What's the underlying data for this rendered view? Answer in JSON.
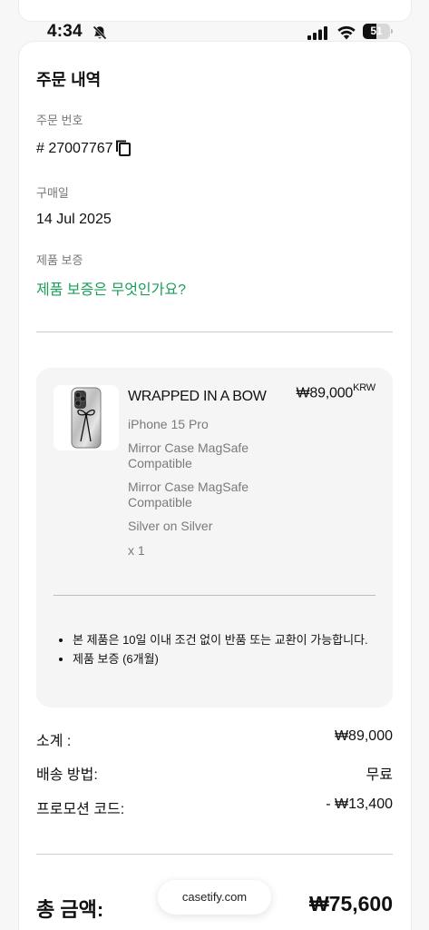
{
  "status_bar": {
    "time": "4:34",
    "battery": "51",
    "battery_fraction": 0.51,
    "icons": [
      "bell-slash-icon",
      "signal-icon",
      "wifi-icon",
      "battery-icon"
    ]
  },
  "order": {
    "title": "주문 내역",
    "order_number_label": "주문 번호",
    "order_number": "# 27007767",
    "purchase_date_label": "구매일",
    "purchase_date": "14 Jul 2025",
    "warranty_label": "제품 보증",
    "warranty_link": "제품 보증은 무엇인가요?"
  },
  "product": {
    "name": "WRAPPED IN A BOW",
    "price": "₩89,000",
    "currency": "KRW",
    "model": "iPhone 15 Pro",
    "case_type_1": "Mirror Case MagSafe Compatible",
    "case_type_2": "Mirror Case MagSafe Compatible",
    "color": "Silver on Silver",
    "quantity": "x 1",
    "notes": [
      "본 제품은 10일 이내 조건 없이 반품 또는 교환이 가능합니다.",
      "제품 보증 (6개월)"
    ]
  },
  "summary": {
    "subtotal_label": "소계 :",
    "subtotal_value": "₩89,000",
    "shipping_label": "배송 방법:",
    "shipping_value": "무료",
    "promo_label": "프로모션 코드:",
    "promo_value": "- ₩13,400",
    "total_label": "총 금액:",
    "total_value": "₩75,600"
  },
  "browser": {
    "url": "casetify.com"
  },
  "colors": {
    "accent_green": "#1a9e5a",
    "text": "#111111",
    "muted": "#777777"
  }
}
